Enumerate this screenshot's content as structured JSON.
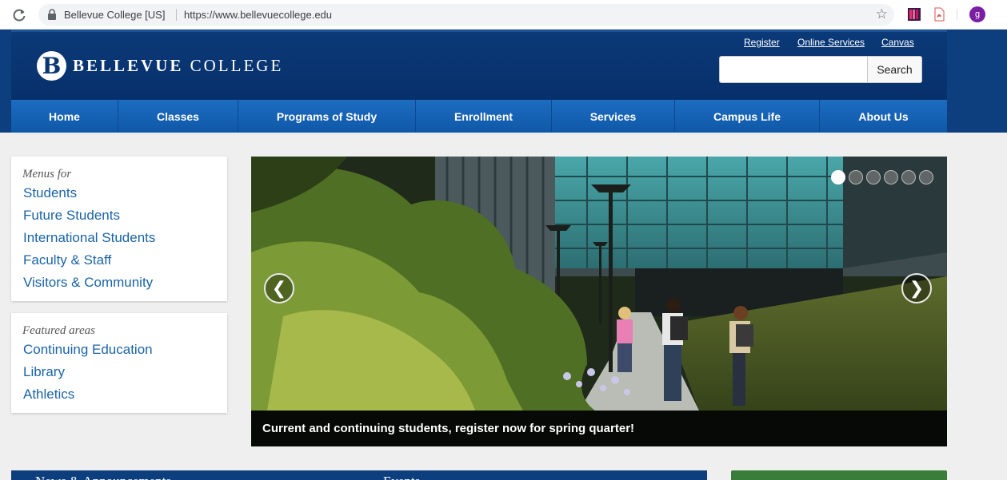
{
  "browser": {
    "site_name": "Bellevue College [US]",
    "url": "https://www.bellevuecollege.edu",
    "avatar_letter": "g"
  },
  "header": {
    "logo_letter": "B",
    "logo_text_a": "BELLEVUE",
    "logo_text_b": "COLLEGE",
    "links": [
      "Register",
      "Online Services",
      "Canvas"
    ],
    "search_placeholder": "",
    "search_button": "Search"
  },
  "nav": {
    "items": [
      "Home",
      "Classes",
      "Programs of Study",
      "Enrollment",
      "Services",
      "Campus Life",
      "About Us"
    ]
  },
  "menus_card": {
    "heading": "Menus for",
    "links": [
      "Students",
      "Future Students",
      "International Students",
      "Faculty & Staff",
      "Visitors & Community"
    ]
  },
  "featured_card": {
    "heading": "Featured areas",
    "links": [
      "Continuing Education",
      "Library",
      "Athletics"
    ]
  },
  "slider": {
    "caption": "Current and continuing students, register now for spring quarter!",
    "slide_count": 6,
    "active_slide": 1,
    "prev_glyph": "❮",
    "next_glyph": "❯"
  },
  "bottom": {
    "news_title": "News & Announcements",
    "events_title": "Events"
  },
  "colors": {
    "brand_blue": "#0d3e7e",
    "nav_blue": "#1563b4",
    "link_blue": "#1b63a6",
    "green": "#3a7d3a"
  }
}
